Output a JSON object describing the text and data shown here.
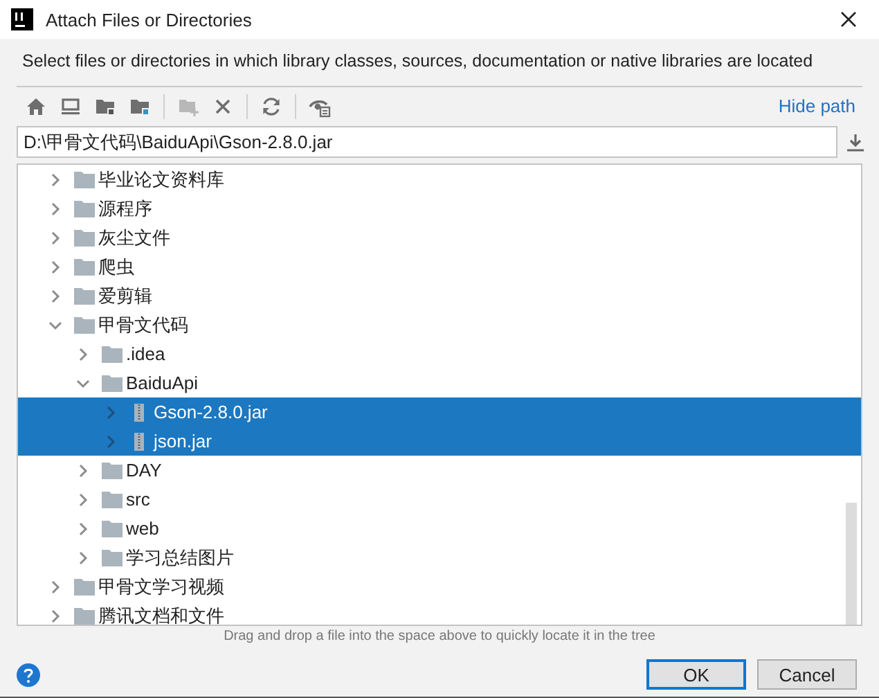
{
  "window": {
    "title": "Attach Files or Directories"
  },
  "description": "Select files or directories in which library classes, sources, documentation or native libraries are located",
  "toolbar": [
    {
      "kind": "home",
      "disabled": false
    },
    {
      "kind": "desktop",
      "disabled": false
    },
    {
      "kind": "project",
      "disabled": false
    },
    {
      "kind": "module",
      "disabled": false
    },
    {
      "kind": "sep"
    },
    {
      "kind": "newfolder",
      "disabled": true
    },
    {
      "kind": "delete",
      "disabled": false
    },
    {
      "kind": "sep"
    },
    {
      "kind": "refresh",
      "disabled": false
    },
    {
      "kind": "sep"
    },
    {
      "kind": "hidden",
      "disabled": false
    }
  ],
  "hide_path_link": "Hide path",
  "path_field": {
    "value": "D:\\甲骨文代码\\BaiduApi\\Gson-2.8.0.jar"
  },
  "tree": [
    {
      "name": "毕业论文资料库",
      "kind": "folder",
      "expanded": false,
      "selected": false
    },
    {
      "name": "源程序",
      "kind": "folder",
      "expanded": false,
      "selected": false
    },
    {
      "name": "灰尘文件",
      "kind": "folder",
      "expanded": false,
      "selected": false
    },
    {
      "name": "爬虫",
      "kind": "folder",
      "expanded": false,
      "selected": false
    },
    {
      "name": "爱剪辑",
      "kind": "folder",
      "expanded": false,
      "selected": false
    },
    {
      "name": "甲骨文代码",
      "kind": "folder",
      "expanded": true,
      "selected": false,
      "children": [
        {
          "name": ".idea",
          "kind": "folder",
          "expanded": false,
          "selected": false
        },
        {
          "name": "BaiduApi",
          "kind": "folder",
          "expanded": true,
          "selected": false,
          "children": [
            {
              "name": "Gson-2.8.0.jar",
              "kind": "jar",
              "expanded": false,
              "selected": true
            },
            {
              "name": "json.jar",
              "kind": "jar",
              "expanded": false,
              "selected": true
            }
          ]
        },
        {
          "name": "DAY",
          "kind": "folder",
          "expanded": false,
          "selected": false
        },
        {
          "name": "src",
          "kind": "folder",
          "expanded": false,
          "selected": false
        },
        {
          "name": "web",
          "kind": "folder",
          "expanded": false,
          "selected": false
        },
        {
          "name": "学习总结图片",
          "kind": "folder",
          "expanded": false,
          "selected": false
        }
      ]
    },
    {
      "name": "甲骨文学习视频",
      "kind": "folder",
      "expanded": false,
      "selected": false
    },
    {
      "name": "腾讯文档和文件",
      "kind": "folder",
      "expanded": false,
      "selected": false
    }
  ],
  "hint": "Drag and drop a file into the space above to quickly locate it in the tree",
  "buttons": [
    {
      "label": "OK",
      "kind": "default"
    },
    {
      "label": "Cancel",
      "kind": "normal"
    }
  ]
}
